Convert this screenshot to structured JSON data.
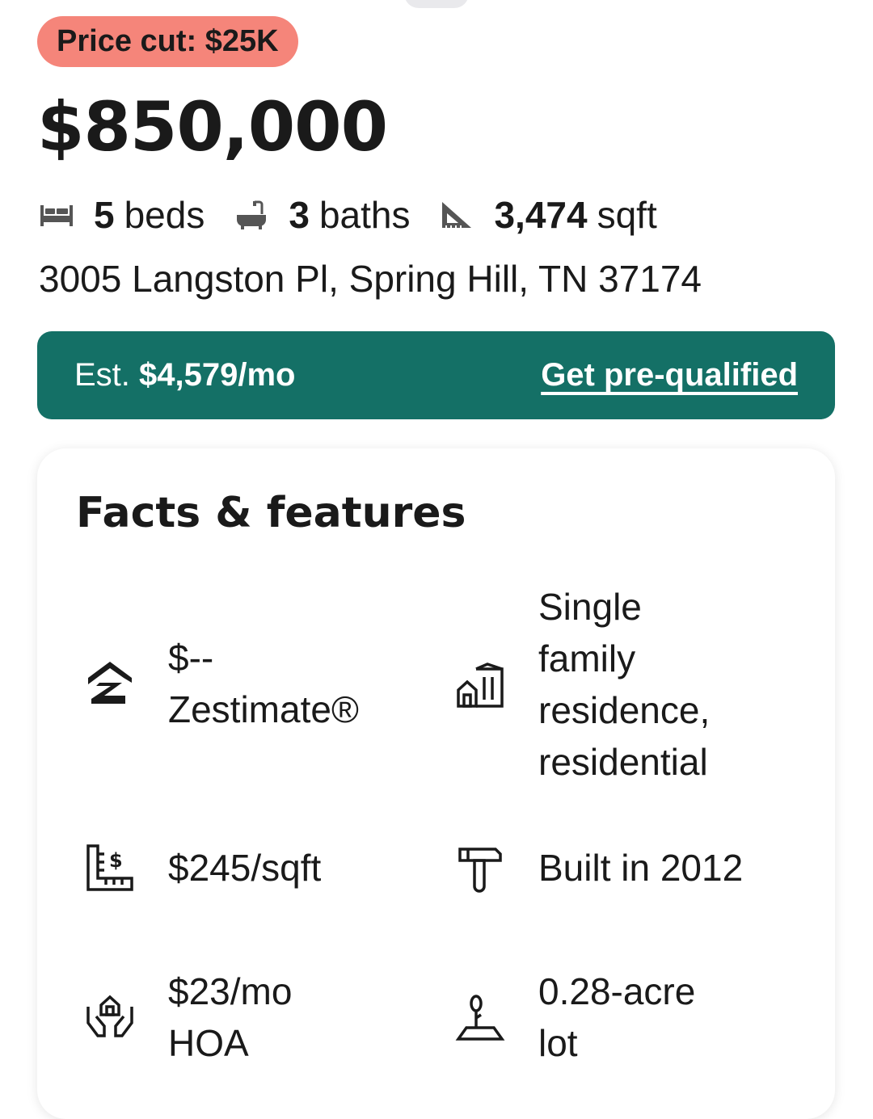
{
  "listing": {
    "badge": "Price cut: $25K",
    "price": "$850,000",
    "beds_value": "5",
    "beds_label": "beds",
    "baths_value": "3",
    "baths_label": "baths",
    "sqft_value": "3,474",
    "sqft_label": "sqft",
    "address": "3005 Langston Pl, Spring Hill, TN 37174"
  },
  "mortgage": {
    "est_label": "Est.",
    "est_value": "$4,579/mo",
    "cta": "Get pre-qualified"
  },
  "facts": {
    "title": "Facts & features",
    "items": [
      {
        "icon": "zestimate-icon",
        "lines": [
          "$--",
          "Zestimate®"
        ]
      },
      {
        "icon": "building-icon",
        "lines": [
          "Single",
          "family",
          "residence,",
          "residential"
        ]
      },
      {
        "icon": "price-per-sqft-icon",
        "lines": [
          "$245/sqft"
        ]
      },
      {
        "icon": "hammer-icon",
        "lines": [
          "Built in 2012"
        ]
      },
      {
        "icon": "hoa-hands-icon",
        "lines": [
          "$23/mo",
          "HOA"
        ]
      },
      {
        "icon": "lot-tree-icon",
        "lines": [
          "0.28-acre",
          "lot"
        ]
      }
    ]
  },
  "colors": {
    "badge": "#f5857a",
    "mortgage_banner": "#147066",
    "text": "#1a1a1a"
  }
}
